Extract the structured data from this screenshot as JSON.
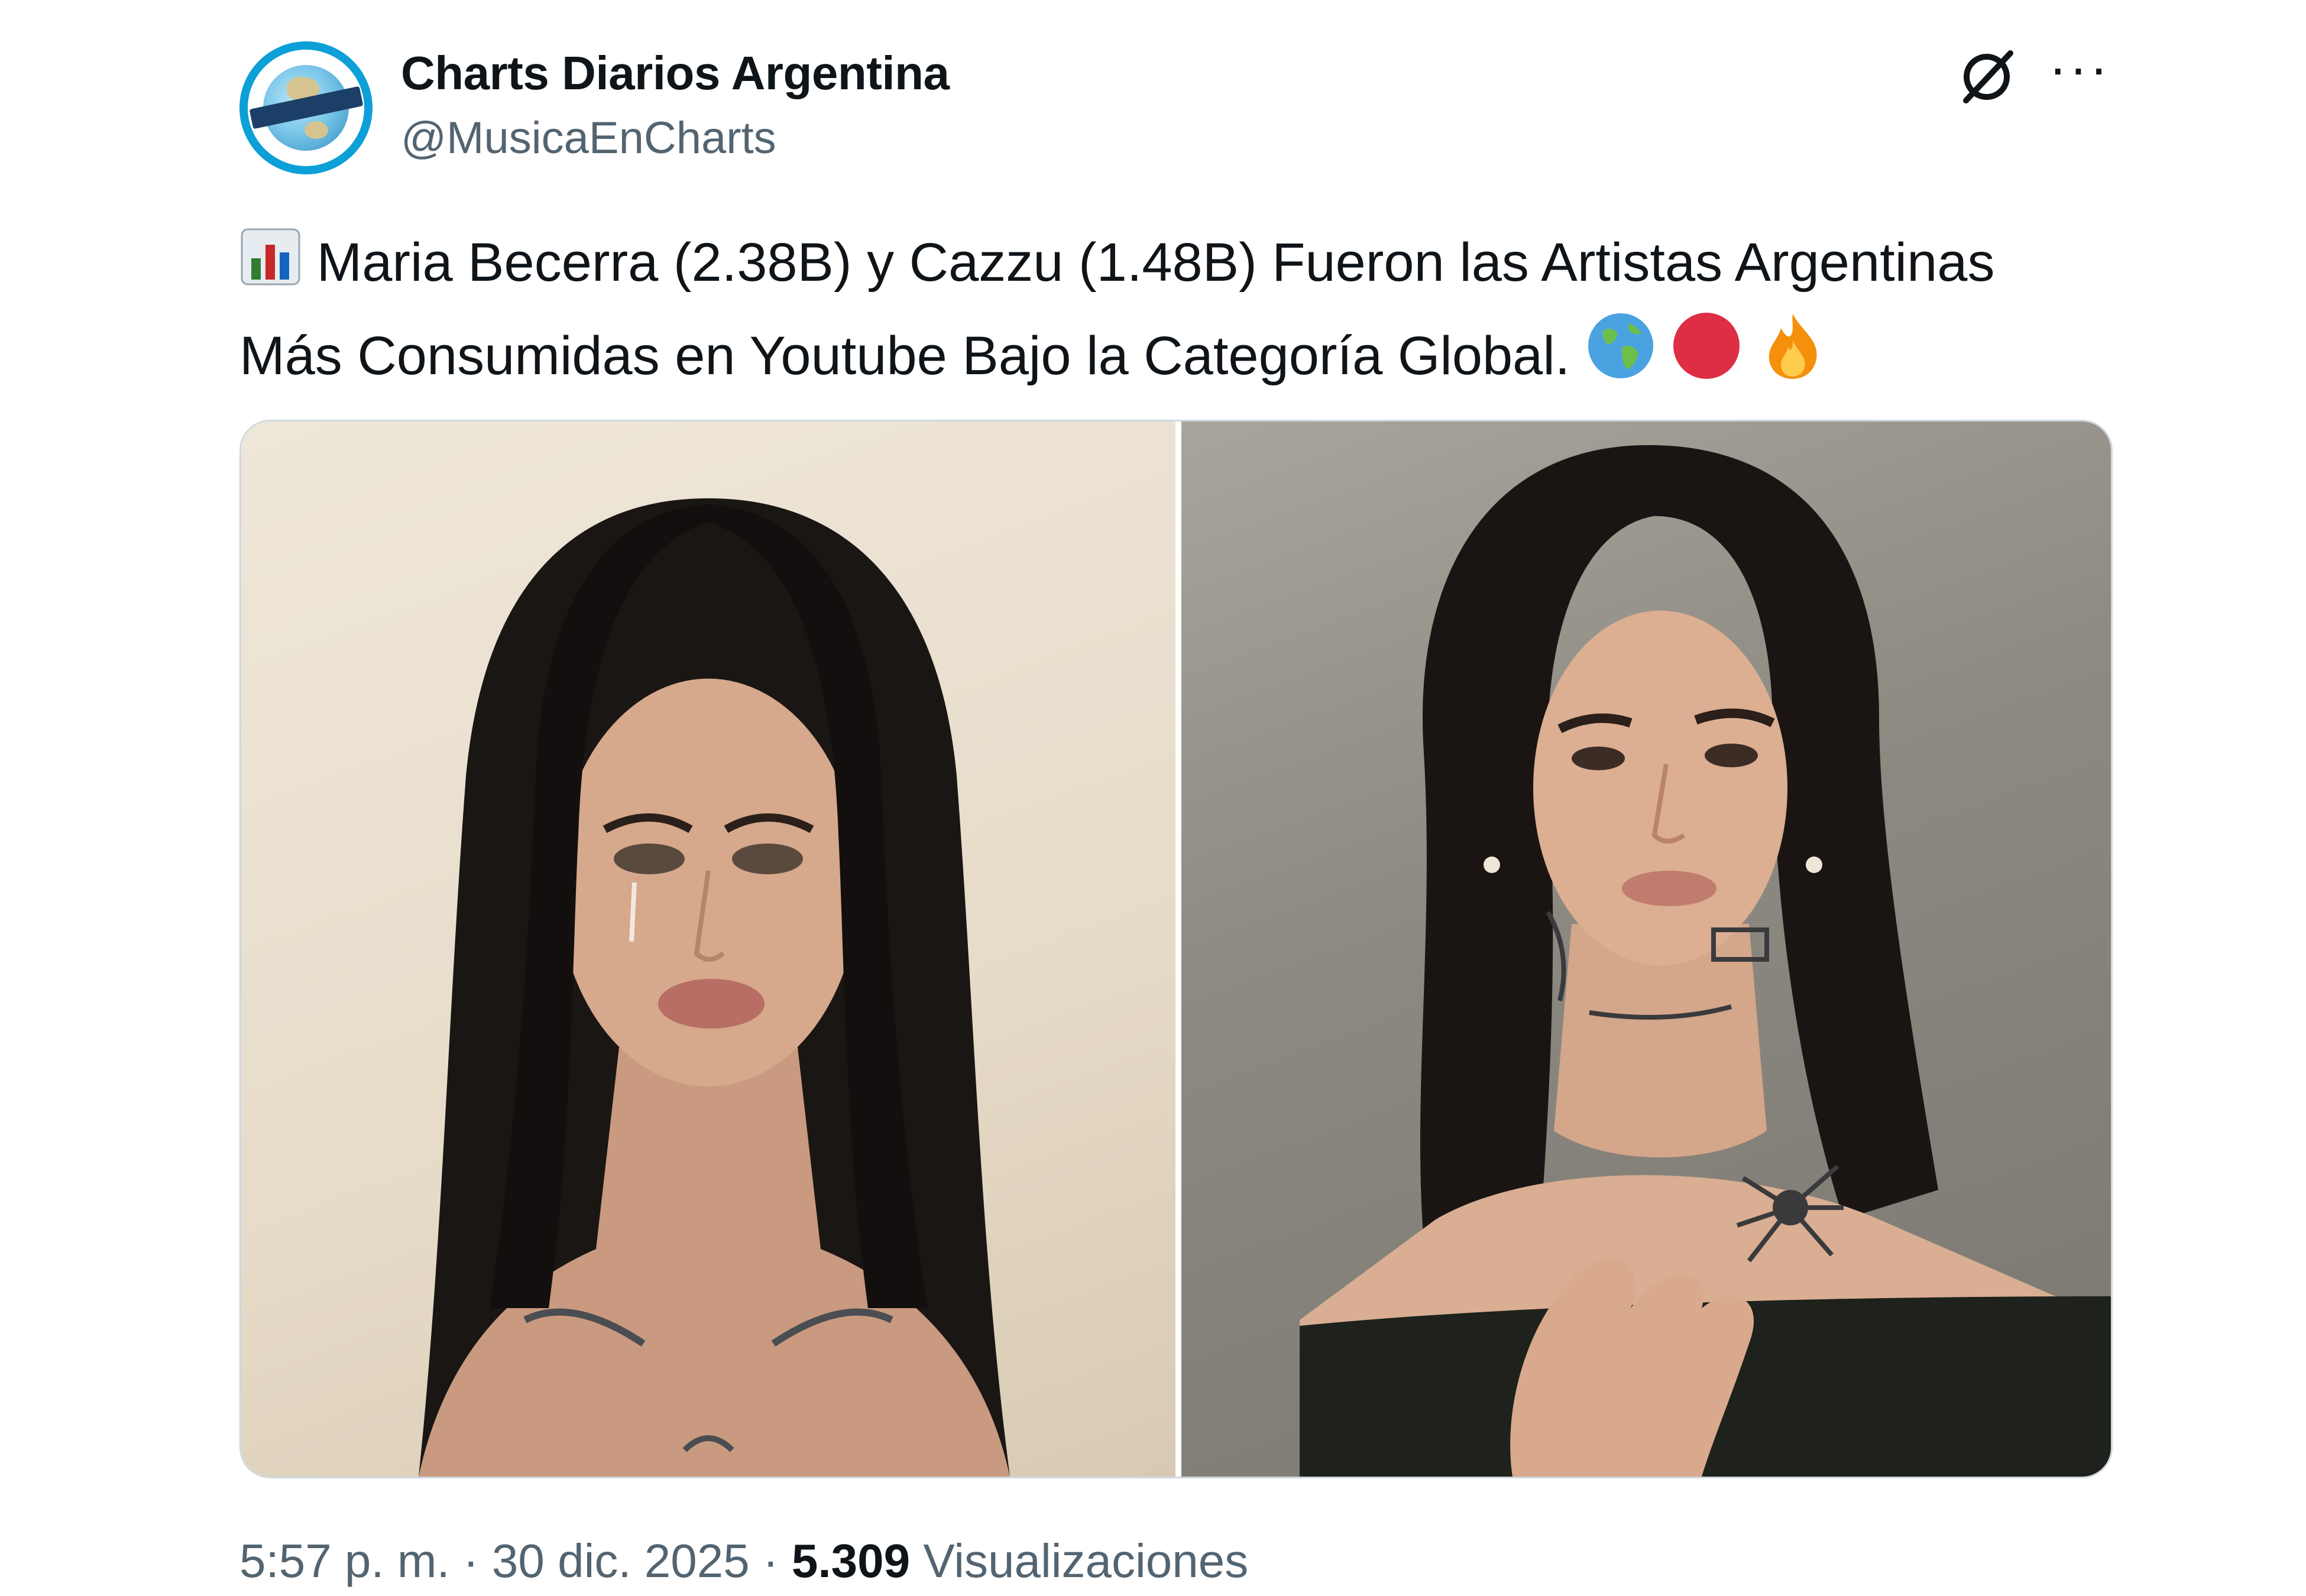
{
  "author": {
    "name": "Charts Diarios Argentina",
    "handle": "@MusicaEnCharts",
    "avatar_icon": "globe-logo-icon",
    "avatar_colors": {
      "ring": "#0c9fd8",
      "band": "#1b3f66"
    }
  },
  "header_actions": {
    "grok_icon": "grok-icon",
    "more_label": "···"
  },
  "tweet": {
    "line1": "Maria Becerra (2.38B) y Cazzu (1.48B) Fueron las Artistas Argentinas",
    "line2": "Más Consumidas en Youtube Bajo la Categoría Global.",
    "emojis": [
      "bar-chart-icon",
      "globe-icon",
      "red-circle-icon",
      "fire-icon"
    ]
  },
  "media": {
    "left_photo": "photo-long-dark-hair-woman-with-tear",
    "right_photo": "photo-woman-with-tattoos-off-shoulder-top"
  },
  "footer": {
    "time": "5:57 p. m.",
    "sep1": "·",
    "date": "30 dic. 2025",
    "sep2": "·",
    "views_count": "5.309",
    "views_label": "Visualizaciones"
  },
  "colors": {
    "text": "#0f1419",
    "secondary": "#536471",
    "border": "#cfd9de"
  }
}
